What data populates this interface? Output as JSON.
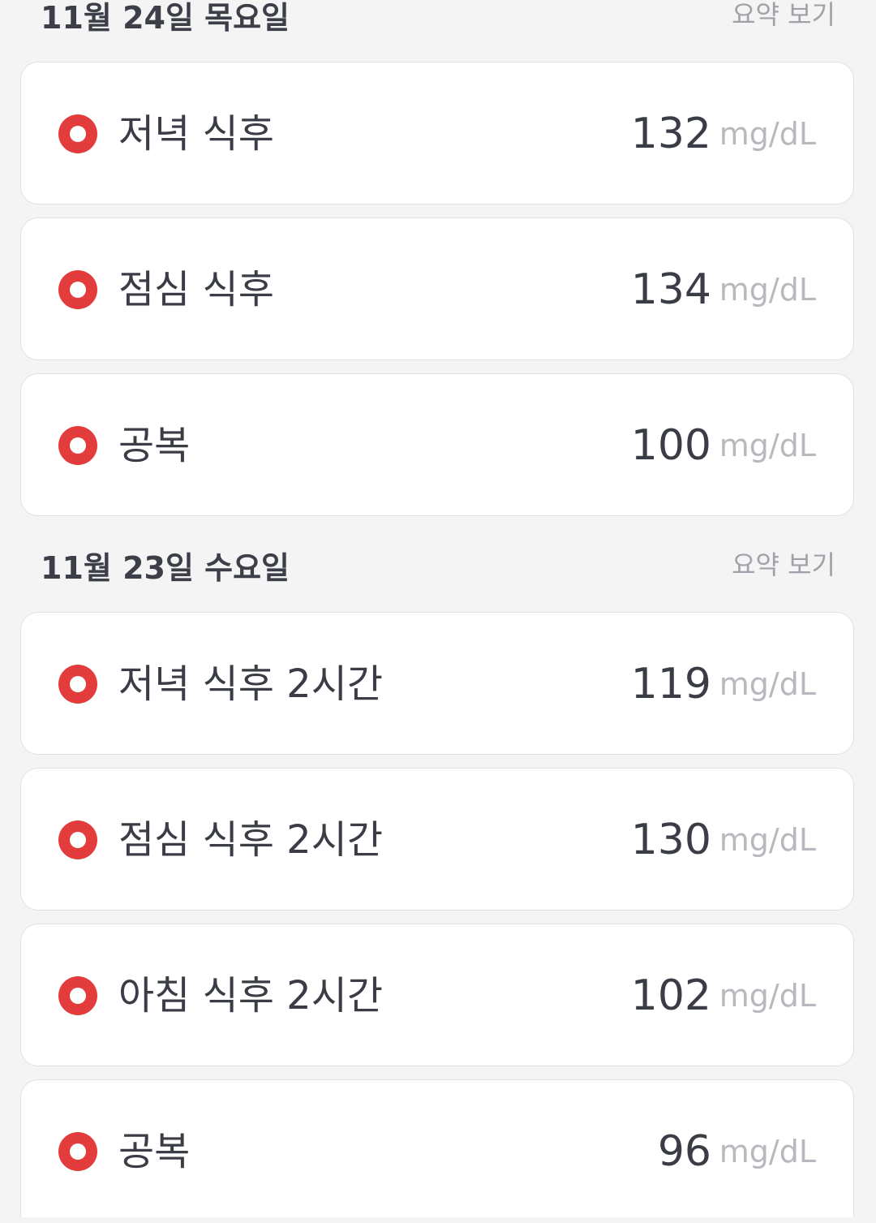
{
  "accent_color": "#e33c3c",
  "icons": {
    "reading_marker": "red-ring-dot-icon"
  },
  "sections": [
    {
      "date": "11월 24일 목요일",
      "summary_label": "요약 보기",
      "readings": [
        {
          "label": "저녁 식후",
          "value": "132",
          "unit": "mg/dL"
        },
        {
          "label": "점심 식후",
          "value": "134",
          "unit": "mg/dL"
        },
        {
          "label": "공복",
          "value": "100",
          "unit": "mg/dL"
        }
      ]
    },
    {
      "date": "11월 23일 수요일",
      "summary_label": "요약 보기",
      "readings": [
        {
          "label": "저녁 식후 2시간",
          "value": "119",
          "unit": "mg/dL"
        },
        {
          "label": "점심 식후 2시간",
          "value": "130",
          "unit": "mg/dL"
        },
        {
          "label": "아침 식후 2시간",
          "value": "102",
          "unit": "mg/dL"
        },
        {
          "label": "공복",
          "value": "96",
          "unit": "mg/dL"
        }
      ]
    }
  ]
}
